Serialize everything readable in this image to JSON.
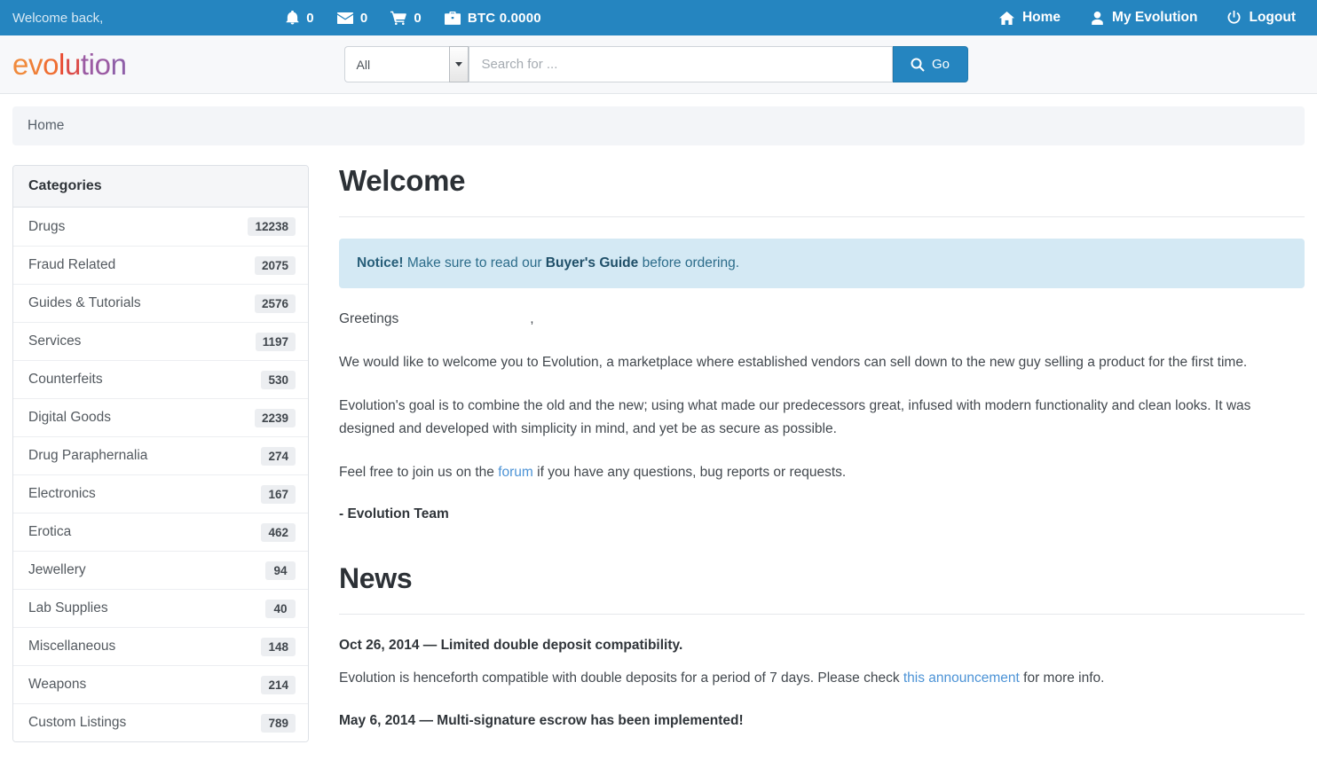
{
  "topbar": {
    "welcome_text": "Welcome back,",
    "stats": [
      {
        "icon": "bell-icon",
        "value": "0"
      },
      {
        "icon": "envelope-icon",
        "value": "0"
      },
      {
        "icon": "shopping-cart-icon",
        "value": "0"
      },
      {
        "icon": "briefcase-icon",
        "value": "BTC 0.0000"
      }
    ],
    "links": [
      {
        "icon": "home-icon",
        "label": "Home"
      },
      {
        "icon": "user-icon",
        "label": "My Evolution"
      },
      {
        "icon": "power-icon",
        "label": "Logout"
      }
    ]
  },
  "masthead": {
    "logo_letters": [
      "e",
      "v",
      "o",
      "l",
      "u",
      "tio",
      "n"
    ],
    "logo_text": "evolution",
    "category_selected": "All",
    "search_placeholder": "Search for ...",
    "search_value": "",
    "go_label": "Go"
  },
  "breadcrumb": {
    "items": [
      "Home"
    ]
  },
  "sidebar": {
    "panel_title": "Categories",
    "categories": [
      {
        "label": "Drugs",
        "count": "12238"
      },
      {
        "label": "Fraud Related",
        "count": "2075"
      },
      {
        "label": "Guides & Tutorials",
        "count": "2576"
      },
      {
        "label": "Services",
        "count": "1197"
      },
      {
        "label": "Counterfeits",
        "count": "530"
      },
      {
        "label": "Digital Goods",
        "count": "2239"
      },
      {
        "label": "Drug Paraphernalia",
        "count": "274"
      },
      {
        "label": "Electronics",
        "count": "167"
      },
      {
        "label": "Erotica",
        "count": "462"
      },
      {
        "label": "Jewellery",
        "count": "94"
      },
      {
        "label": "Lab Supplies",
        "count": "40"
      },
      {
        "label": "Miscellaneous",
        "count": "148"
      },
      {
        "label": "Weapons",
        "count": "214"
      },
      {
        "label": "Custom Listings",
        "count": "789"
      }
    ]
  },
  "main": {
    "welcome_heading": "Welcome",
    "notice": {
      "prefix_bold": "Notice!",
      "text_before_link": " Make sure to read our ",
      "link_label": "Buyer's Guide",
      "text_after_link": " before ordering."
    },
    "greeting_prefix": "Greetings",
    "greeting_suffix": ",",
    "paragraph_1": "We would like to welcome you to Evolution, a marketplace where established vendors can sell down to the new guy selling a product for the first time.",
    "paragraph_2": "Evolution's goal is to combine the old and the new; using what made our predecessors great, infused with modern functionality and clean looks. It was designed and developed with simplicity in mind, and yet be as secure as possible.",
    "paragraph_3_before": "Feel free to join us on the ",
    "paragraph_3_link": "forum",
    "paragraph_3_after": " if you have any questions, bug reports or requests.",
    "signoff": "- Evolution Team",
    "news_heading": "News",
    "news": [
      {
        "headline": "Oct 26, 2014 — Limited double deposit compatibility.",
        "body_before": "Evolution is henceforth compatible with double deposits for a period of 7 days. Please check ",
        "body_link": "this announcement",
        "body_after": " for more info."
      },
      {
        "headline": "May 6, 2014 — Multi-signature escrow has been implemented!",
        "body_before": "",
        "body_link": "",
        "body_after": ""
      }
    ]
  },
  "colors": {
    "brand_blue": "#2585c0",
    "notice_bg": "#d4e9f4",
    "notice_text": "#2c6c8a",
    "link_blue": "#4c93d6",
    "logo_orange": "#f08a3c",
    "logo_red": "#e8492f",
    "logo_purple": "#8f5fa8"
  }
}
